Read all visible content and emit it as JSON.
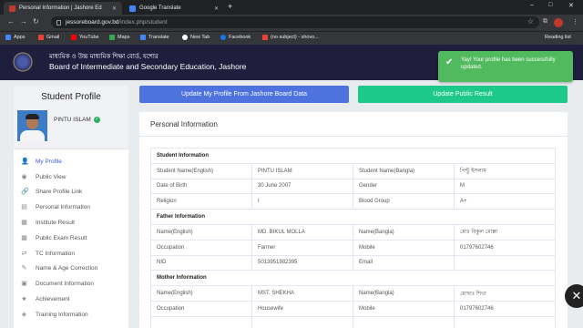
{
  "browser": {
    "tabs": [
      {
        "title": "Personal Information | Jashore Ed",
        "active": true
      },
      {
        "title": "Google Translate",
        "active": false
      }
    ],
    "new_tab": "+",
    "window_controls": {
      "minimize": "–",
      "maximize": "□",
      "close": "✕"
    },
    "url_host": "jessoreboard.gov.bd",
    "url_path": "/index.php/student",
    "bookmarks": [
      {
        "label": "Apps",
        "color": "#4285f4"
      },
      {
        "label": "Gmail",
        "color": "#ea4335"
      },
      {
        "label": "YouTube",
        "color": "#ff0000"
      },
      {
        "label": "Maps",
        "color": "#34a853"
      },
      {
        "label": "Translate",
        "color": "#4285f4"
      },
      {
        "label": "New Tab",
        "color": "#ffffff"
      },
      {
        "label": "Facebook",
        "color": "#1877f2"
      },
      {
        "label": "(no subject) - shovo...",
        "color": "#ea4335"
      }
    ],
    "reading_list": "Reading list"
  },
  "header": {
    "title_bangla": "মাধ্যমিক ও উচ্চ মাধ্যমিক শিক্ষা বোর্ড, যশোর",
    "title_english": "Board of Intermediate and Secondary Education, Jashore"
  },
  "toast": {
    "message": "Yay! Your profile has been successfully updated."
  },
  "sidebar": {
    "title": "Student Profile",
    "student_name": "PINTU ISLAM",
    "items": [
      {
        "label": "My Profile",
        "icon": "user-icon",
        "glyph": "👤",
        "active": true
      },
      {
        "label": "Public View",
        "icon": "eye-icon",
        "glyph": "◉",
        "active": false
      },
      {
        "label": "Share Profile Link",
        "icon": "link-icon",
        "glyph": "🔗",
        "active": false
      },
      {
        "label": "Personal Information",
        "icon": "id-card-icon",
        "glyph": "▤",
        "active": false
      },
      {
        "label": "Institute Result",
        "icon": "graduation-icon",
        "glyph": "▦",
        "active": false
      },
      {
        "label": "Public Exam Result",
        "icon": "result-icon",
        "glyph": "▦",
        "active": false
      },
      {
        "label": "TC Information",
        "icon": "transfer-icon",
        "glyph": "⇄",
        "active": false
      },
      {
        "label": "Name & Age Correction",
        "icon": "edit-icon",
        "glyph": "✎",
        "active": false
      },
      {
        "label": "Document Information",
        "icon": "document-icon",
        "glyph": "▣",
        "active": false
      },
      {
        "label": "Achievement",
        "icon": "trophy-icon",
        "glyph": "★",
        "active": false
      },
      {
        "label": "Training Information",
        "icon": "training-icon",
        "glyph": "◈",
        "active": false
      }
    ]
  },
  "buttons": {
    "update_profile": "Update My Profile From Jashore Board Data",
    "update_public_result": "Update Public Result"
  },
  "content": {
    "title": "Personal Information",
    "rows": [
      {
        "type": "section",
        "label": "Student Information"
      },
      {
        "type": "row",
        "cells": [
          "Student Name(English)",
          "PINTU ISLAM",
          "Student Name(Bangla)",
          "পিন্টু ইসলাম"
        ]
      },
      {
        "type": "row",
        "cells": [
          "Date of Birth",
          "30 June 2007",
          "Gender",
          "M"
        ]
      },
      {
        "type": "row",
        "cells": [
          "Religion",
          "I",
          "Blood Group",
          "A+"
        ]
      },
      {
        "type": "section",
        "label": "Father Information"
      },
      {
        "type": "row",
        "cells": [
          "Name(English)",
          "MD. BIKUL MOLLA",
          "Name(Bangla)",
          "মোঃ বিকুল মোল্লা"
        ]
      },
      {
        "type": "row",
        "cells": [
          "Occupation",
          "Farmer",
          "Mobile",
          "01797602746"
        ]
      },
      {
        "type": "row",
        "cells": [
          "NID",
          "5013951982395",
          "Email",
          ""
        ]
      },
      {
        "type": "section",
        "label": "Mother Information"
      },
      {
        "type": "row",
        "cells": [
          "Name(English)",
          "MST. SHEKHA",
          "Name(Bangla)",
          "মোছাঃ শিখা"
        ]
      },
      {
        "type": "row",
        "cells": [
          "Occupation",
          "Housewife",
          "Mobile",
          "01797602746"
        ]
      },
      {
        "type": "row",
        "cells": [
          "",
          "",
          "",
          ""
        ]
      }
    ]
  },
  "close_button": "✕"
}
